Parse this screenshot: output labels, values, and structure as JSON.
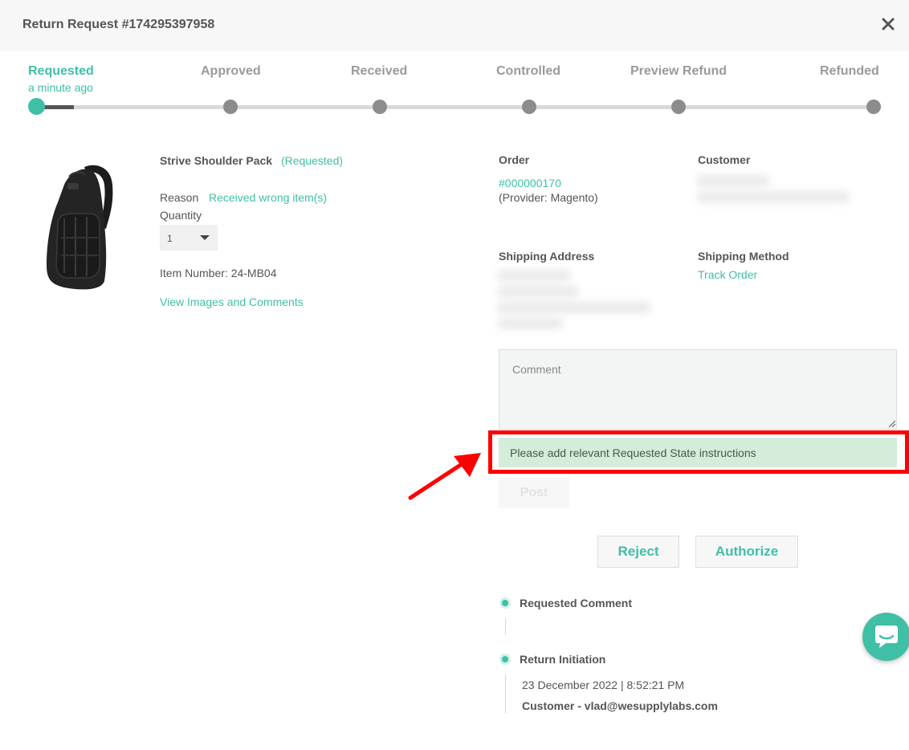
{
  "header": {
    "title": "Return Request #174295397958"
  },
  "steps": {
    "items": [
      {
        "label": "Requested",
        "active": true
      },
      {
        "label": "Approved",
        "active": false
      },
      {
        "label": "Received",
        "active": false
      },
      {
        "label": "Controlled",
        "active": false
      },
      {
        "label": "Preview Refund",
        "active": false
      },
      {
        "label": "Refunded",
        "active": false
      }
    ],
    "current_time": "a minute ago",
    "progress": 0.05
  },
  "product": {
    "name": "Strive Shoulder Pack",
    "status": "(Requested)",
    "reason_label": "Reason",
    "reason_value": "Received wrong item(s)",
    "quantity_label": "Quantity",
    "quantity_value": "1",
    "item_number": "Item Number: 24-MB04",
    "view_link": "View Images and Comments"
  },
  "order": {
    "label": "Order",
    "number": "#000000170",
    "provider": "(Provider: Magento)"
  },
  "customer": {
    "label": "Customer"
  },
  "shipping": {
    "address_label": "Shipping Address",
    "method_label": "Shipping Method",
    "track_link": "Track Order"
  },
  "comment": {
    "placeholder": "Comment",
    "notice": "Please add relevant Requested State instructions",
    "post_label": "Post"
  },
  "actions": {
    "reject_label": "Reject",
    "authorize_label": "Authorize"
  },
  "timeline": {
    "items": [
      {
        "title": "Requested Comment"
      },
      {
        "title": "Return Initiation",
        "date": "23 December 2022 | 8:52:21 PM",
        "author": "Customer - vlad@wesupplylabs.com"
      }
    ]
  },
  "colors": {
    "accent": "#3fbfa6",
    "notice_bg": "#d4ecda",
    "annotation": "#ff0000"
  },
  "icons": [
    "close-icon",
    "chevron-down-icon",
    "chat-icon",
    "arrow-annotation-icon"
  ]
}
